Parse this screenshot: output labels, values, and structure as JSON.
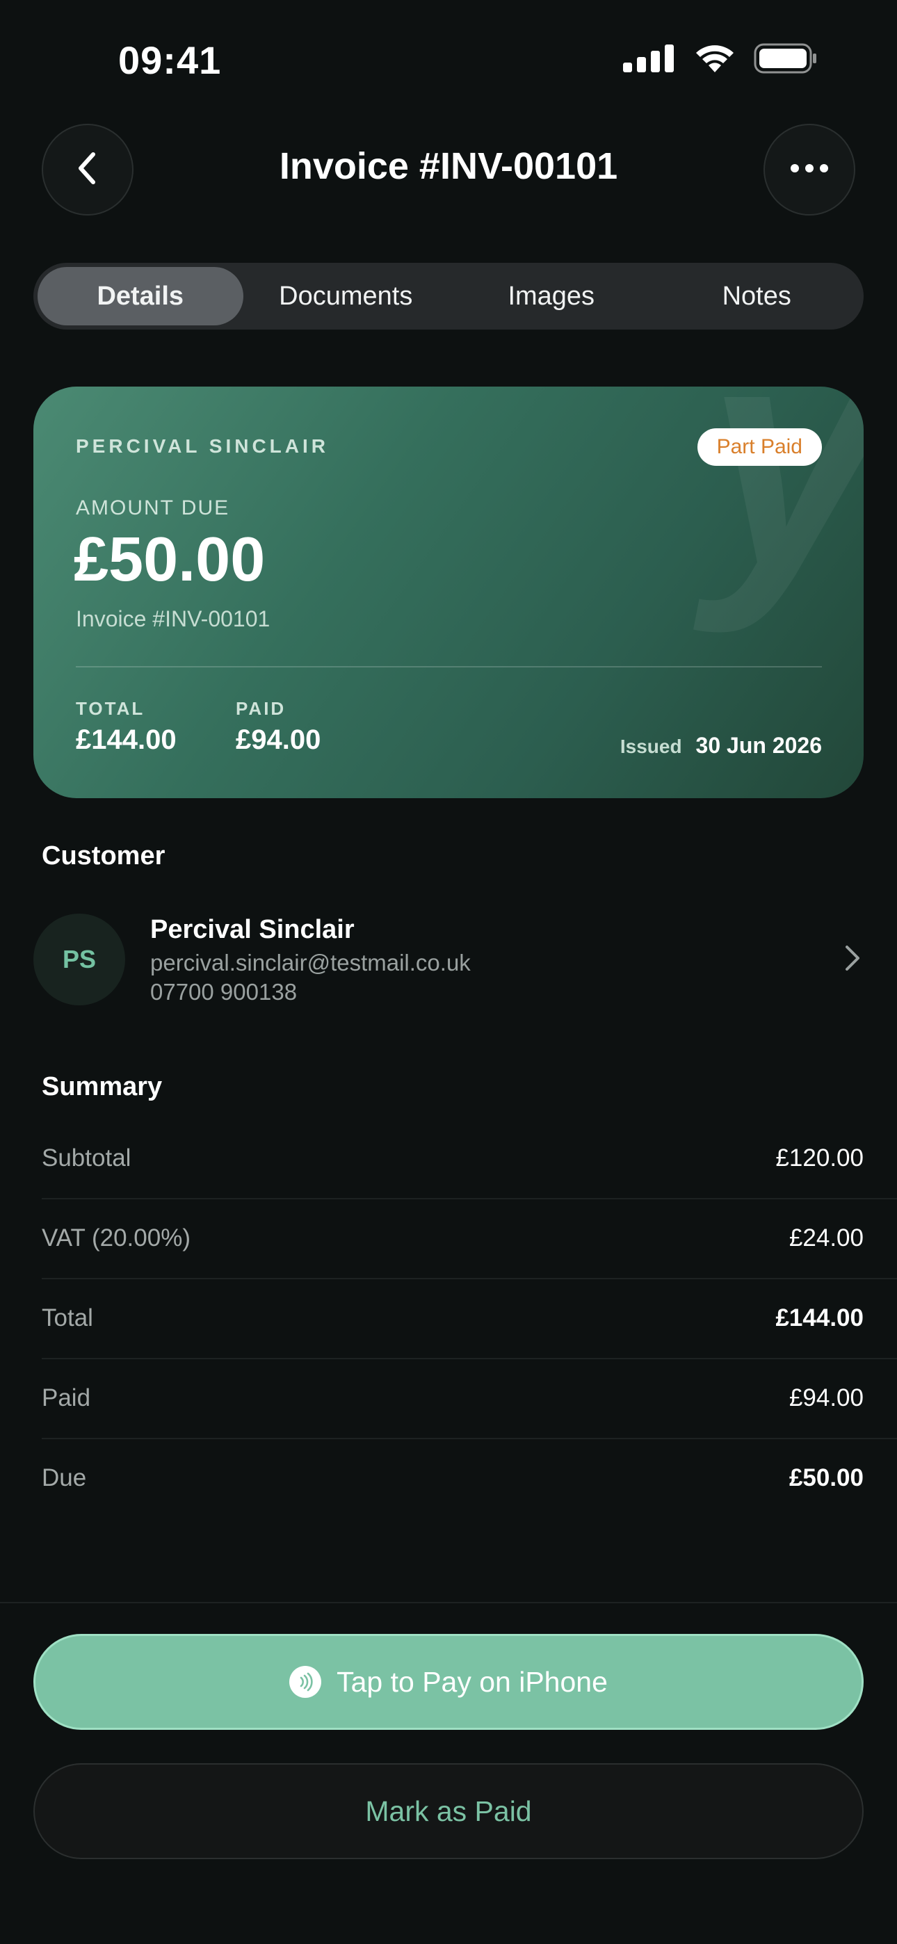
{
  "status_bar": {
    "time": "09:41"
  },
  "header": {
    "title": "Invoice #INV-00101",
    "back_icon": "chevron-left-icon",
    "more_icon": "ellipsis-icon"
  },
  "tabs": [
    {
      "label": "Details",
      "active": true
    },
    {
      "label": "Documents",
      "active": false
    },
    {
      "label": "Images",
      "active": false
    },
    {
      "label": "Notes",
      "active": false
    }
  ],
  "card": {
    "customer": "PERCIVAL SINCLAIR",
    "status_badge": "Part Paid",
    "amount_label": "AMOUNT DUE",
    "amount_due": "£50.00",
    "invoice_number": "Invoice #INV-00101",
    "total_label": "TOTAL",
    "total": "£144.00",
    "paid_label": "PAID",
    "paid": "£94.00",
    "issued_label": "Issued",
    "issued_date": "30 Jun 2026",
    "watermark": "y",
    "colors": {
      "card_start": "#4b8a73",
      "card_end": "#224739",
      "badge_text": "#d97f2b"
    }
  },
  "customer_section": {
    "title": "Customer",
    "initials": "PS",
    "name": "Percival Sinclair",
    "email": "percival.sinclair@testmail.co.uk",
    "phone": "07700 900138"
  },
  "summary": {
    "title": "Summary",
    "rows": [
      {
        "label": "Subtotal",
        "value": "£120.00",
        "bold": false
      },
      {
        "label": "VAT (20.00%)",
        "value": "£24.00",
        "bold": false
      },
      {
        "label": "Total",
        "value": "£144.00",
        "bold": true
      },
      {
        "label": "Paid",
        "value": "£94.00",
        "bold": false
      },
      {
        "label": "Due",
        "value": "£50.00",
        "bold": true
      }
    ]
  },
  "actions": {
    "tap_to_pay": "Tap to Pay on iPhone",
    "tap_to_pay_icon": "contactless-icon",
    "mark_as_paid": "Mark as Paid",
    "accent": "#7bc2a4"
  }
}
